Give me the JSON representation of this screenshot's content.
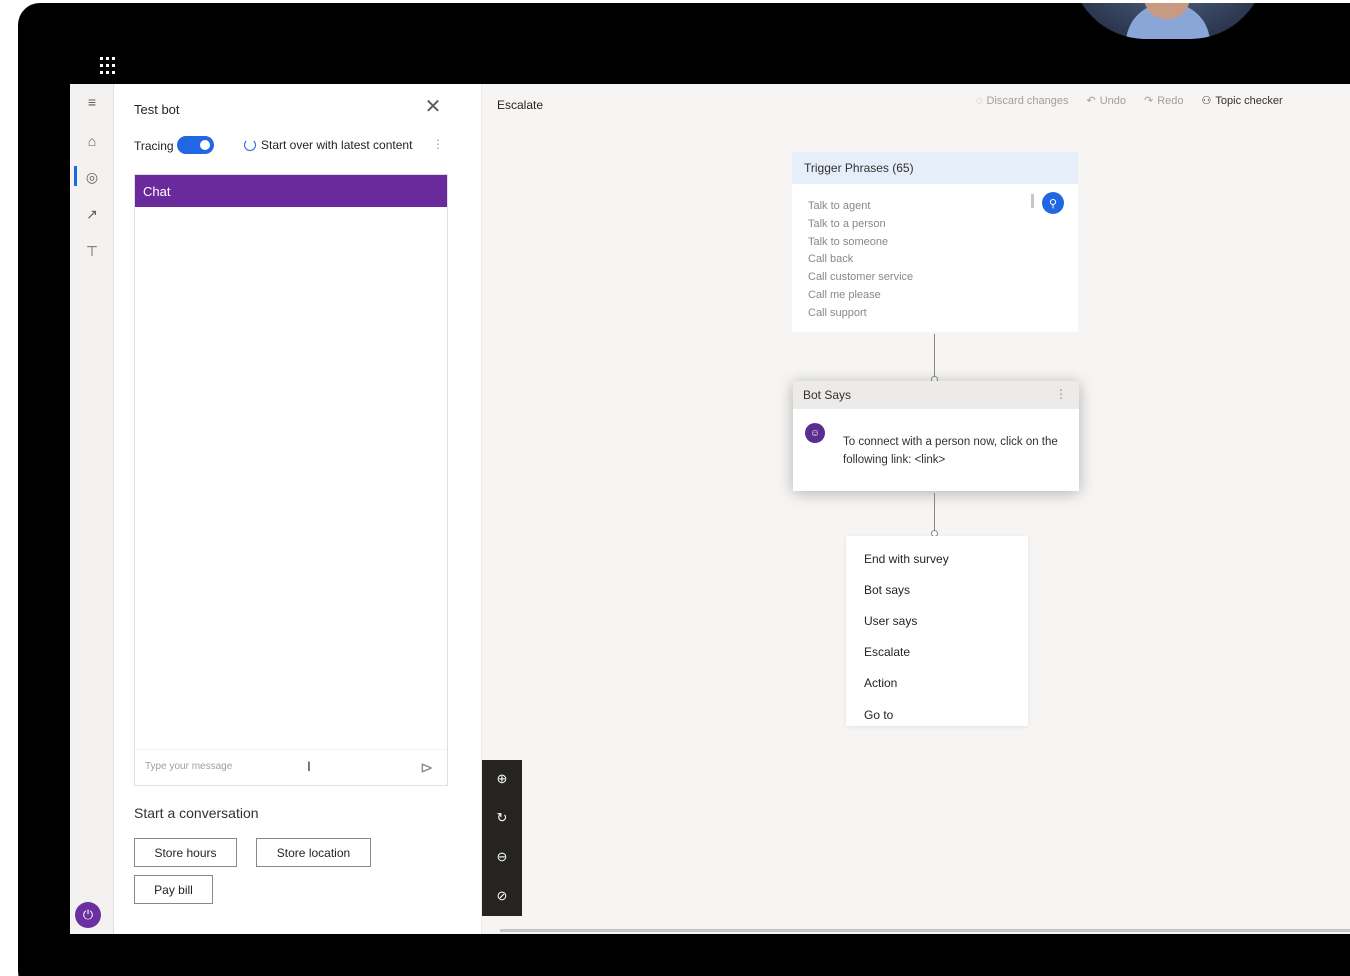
{
  "shell": {
    "waffle_icon": "waffle-icon"
  },
  "rail": {
    "items": [
      {
        "icon": "hamburger-icon",
        "glyph": "≡"
      },
      {
        "icon": "home-icon",
        "glyph": "⌂"
      },
      {
        "icon": "topics-icon",
        "glyph": "◎"
      },
      {
        "icon": "analytics-icon",
        "glyph": "↗"
      },
      {
        "icon": "entities-icon",
        "glyph": "⊤"
      }
    ],
    "bottom_badge_glyph": "⏻"
  },
  "test_bot": {
    "title": "Test bot",
    "close_glyph": "✕",
    "tracing_label": "Tracing",
    "tracing_on": true,
    "restart_label": "Start over with latest content",
    "more_glyph": "⋮",
    "chat_header": "Chat",
    "input_placeholder": "Type your message",
    "input_cursor": "I",
    "send_glyph": "⊳",
    "start_title": "Start a conversation",
    "suggestions": [
      "Store hours",
      "Store location",
      "Pay bill"
    ]
  },
  "canvas": {
    "topic_name": "Escalate",
    "toolbar": {
      "discard": "Discard changes",
      "undo": "Undo",
      "redo": "Redo",
      "topic_checker": "Topic checker"
    },
    "trigger_node": {
      "title": "Trigger Phrases (65)",
      "phrases": [
        "Talk to agent",
        "Talk to a person",
        "Talk to someone",
        "Call back",
        "Call customer service",
        "Call me please",
        "Call support"
      ]
    },
    "bot_node": {
      "title": "Bot Says",
      "message": "To connect with a person now, click on the following link: <link>"
    },
    "add_menu": [
      "End with survey",
      "Bot says",
      "User says",
      "Escalate",
      "Action",
      "Go to"
    ],
    "zoom_controls": [
      {
        "icon": "zoom-in-icon",
        "glyph": "⊕"
      },
      {
        "icon": "reset-icon",
        "glyph": "↻"
      },
      {
        "icon": "zoom-out-icon",
        "glyph": "⊖"
      },
      {
        "icon": "fit-icon",
        "glyph": "⊘"
      }
    ]
  }
}
